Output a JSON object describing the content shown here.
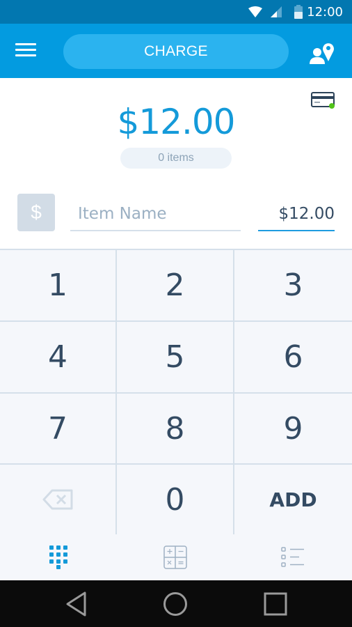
{
  "status_bar": {
    "time": "12:00",
    "icons": [
      "wifi-icon",
      "signal-icon",
      "battery-icon"
    ]
  },
  "app_bar": {
    "menu_icon": "hamburger-menu-icon",
    "charge_label": "CHARGE",
    "location_icon": "user-location-icon"
  },
  "amount": {
    "total": "$12.00",
    "items_count": "0 items",
    "card_reader_icon": "card-reader-icon",
    "card_reader_status_color": "#52c41a"
  },
  "item_entry": {
    "type_icon_label": "$",
    "item_name_placeholder": "Item Name",
    "item_name_value": "",
    "price_value": "$12.00"
  },
  "keypad": {
    "keys": [
      "1",
      "2",
      "3",
      "4",
      "5",
      "6",
      "7",
      "8",
      "9",
      "backspace",
      "0",
      "ADD"
    ]
  },
  "tabs": [
    {
      "name": "keypad",
      "icon": "keypad-icon",
      "active": true
    },
    {
      "name": "calculator",
      "icon": "calculator-icon",
      "active": false
    },
    {
      "name": "item-list",
      "icon": "list-icon",
      "active": false
    }
  ],
  "nav_bar": {
    "buttons": [
      "back",
      "home",
      "recents"
    ]
  },
  "colors": {
    "primary": "#039be0",
    "status_bar": "#0277b0",
    "accent_text": "#149ad9",
    "key_text": "#344b63",
    "divider": "#d5e0ea"
  }
}
